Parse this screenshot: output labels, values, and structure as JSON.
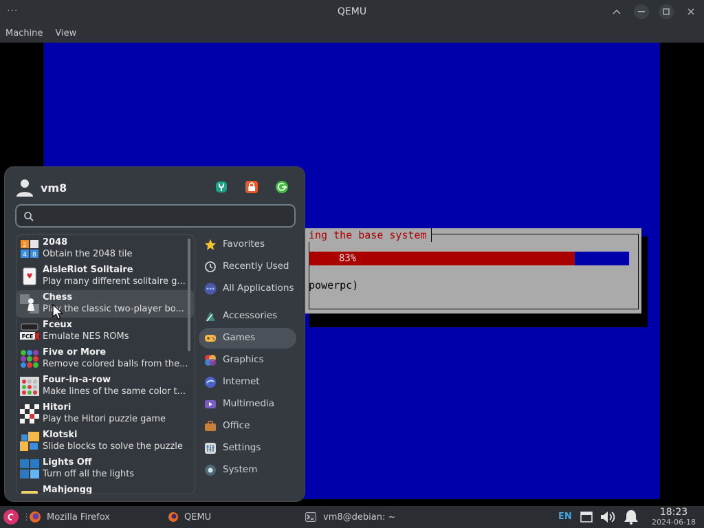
{
  "window": {
    "title": "QEMU"
  },
  "menubar": {
    "items": [
      "Machine",
      "View"
    ]
  },
  "guest": {
    "dialog_title": "ing the base system",
    "progress": {
      "percent": 83,
      "label": "83%"
    },
    "detail": "powerpc)"
  },
  "appmenu": {
    "username": "vm8",
    "search_placeholder": "",
    "apps": [
      {
        "name": "2048",
        "desc": "Obtain the 2048 tile",
        "icon": "2048-icon"
      },
      {
        "name": "AisleRiot Solitaire",
        "desc": "Play many different solitaire g...",
        "icon": "cards-icon"
      },
      {
        "name": "Chess",
        "desc": "Play the classic two-player bo...",
        "icon": "chess-icon"
      },
      {
        "name": "Fceux",
        "desc": "Emulate NES ROMs",
        "icon": "fceux-icon"
      },
      {
        "name": "Five or More",
        "desc": "Remove colored balls from the...",
        "icon": "five-or-more-icon"
      },
      {
        "name": "Four-in-a-row",
        "desc": "Make lines of the same color t...",
        "icon": "four-in-a-row-icon"
      },
      {
        "name": "Hitori",
        "desc": "Play the Hitori puzzle game",
        "icon": "hitori-icon"
      },
      {
        "name": "Klotski",
        "desc": "Slide blocks to solve the puzzle",
        "icon": "klotski-icon"
      },
      {
        "name": "Lights Off",
        "desc": "Turn off all the lights",
        "icon": "lights-off-icon"
      },
      {
        "name": "Mahjongg",
        "desc": "",
        "icon": "mahjongg-icon"
      }
    ],
    "categories": [
      {
        "label": "Favorites",
        "icon": "star-icon"
      },
      {
        "label": "Recently Used",
        "icon": "clock-icon"
      },
      {
        "label": "All Applications",
        "icon": "dots-icon"
      },
      {
        "label": "Accessories",
        "icon": "accessories-icon"
      },
      {
        "label": "Games",
        "icon": "gamepad-icon"
      },
      {
        "label": "Graphics",
        "icon": "graphics-icon"
      },
      {
        "label": "Internet",
        "icon": "internet-icon"
      },
      {
        "label": "Multimedia",
        "icon": "multimedia-icon"
      },
      {
        "label": "Office",
        "icon": "office-icon"
      },
      {
        "label": "Settings",
        "icon": "settings-icon"
      },
      {
        "label": "System",
        "icon": "system-icon"
      }
    ],
    "selected_category": "Games",
    "highlighted_app": "Chess"
  },
  "taskbar": {
    "tasks": [
      {
        "label": "Mozilla Firefox",
        "icon": "firefox-icon"
      },
      {
        "label": "QEMU",
        "icon": "qemu-icon"
      },
      {
        "label": "vm8@debian: ~",
        "icon": "terminal-icon"
      }
    ],
    "keyboard_layout": "EN",
    "time": "18:23",
    "date": "2024-06-18"
  },
  "colors": {
    "guest_blue": "#0000aa",
    "progress_red": "#aa0000",
    "accent_blue": "#4aa3df",
    "menu_bg": "#353a40"
  }
}
